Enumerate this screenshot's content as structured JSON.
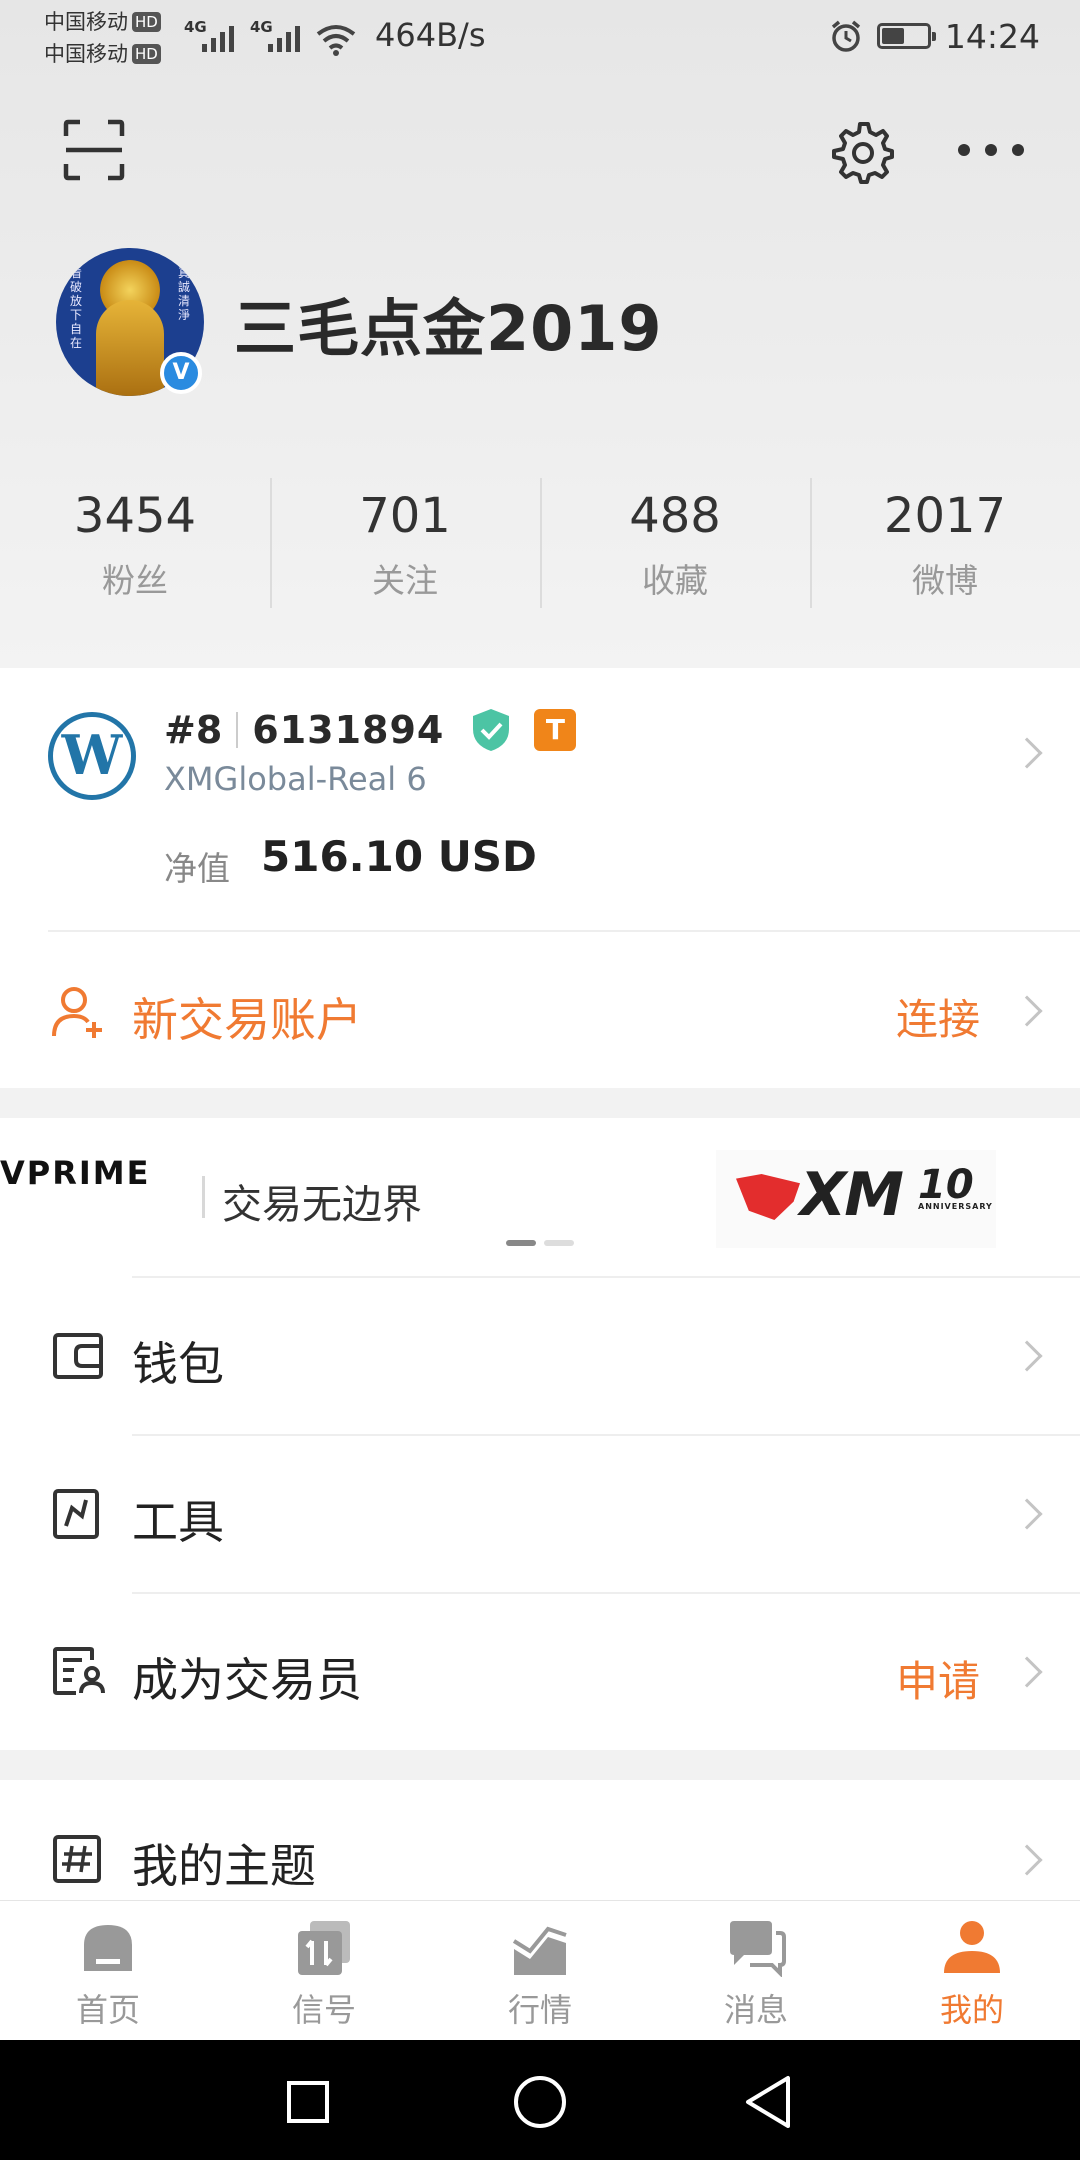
{
  "status_bar": {
    "carrier_1": "中国移动",
    "carrier_2": "中国移动",
    "hd_badge": "HD",
    "signal_1_gen": "4G",
    "signal_2_gen": "4G",
    "net_speed": "464B/s",
    "time": "14:24",
    "battery_level": 0.5
  },
  "profile": {
    "username": "三毛点金2019",
    "verified_badge": "V"
  },
  "stats": [
    {
      "value": "3454",
      "label": "粉丝"
    },
    {
      "value": "701",
      "label": "关注"
    },
    {
      "value": "488",
      "label": "收藏"
    },
    {
      "value": "2017",
      "label": "微博"
    }
  ],
  "account": {
    "rank": "#8",
    "account_id": "6131894",
    "tier_badge": "T",
    "server": "XMGlobal-Real 6",
    "equity_label": "净值",
    "equity_value": "516.10 USD"
  },
  "new_account": {
    "label": "新交易账户",
    "action": "连接"
  },
  "banner": {
    "left_text": "VPRIME",
    "tagline": "交易无边界",
    "brand": "XM",
    "anniversary_number": "10",
    "anniversary_label": "ANNIVERSARY"
  },
  "menu": [
    {
      "label": "钱包",
      "action": ""
    },
    {
      "label": "工具",
      "action": ""
    },
    {
      "label": "成为交易员",
      "action": "申请"
    },
    {
      "label": "我的主题",
      "action": ""
    }
  ],
  "bottom_nav": [
    {
      "label": "首页",
      "icon": "home-icon",
      "active": false
    },
    {
      "label": "信号",
      "icon": "signal-icon",
      "active": false
    },
    {
      "label": "行情",
      "icon": "market-chart-icon",
      "active": false
    },
    {
      "label": "消息",
      "icon": "message-icon",
      "active": false
    },
    {
      "label": "我的",
      "icon": "profile-icon",
      "active": true
    }
  ],
  "colors": {
    "accent": "#f07a32",
    "verified_blue": "#2a8be0",
    "shield_teal": "#4cc4a4",
    "tier_orange": "#f08519"
  }
}
